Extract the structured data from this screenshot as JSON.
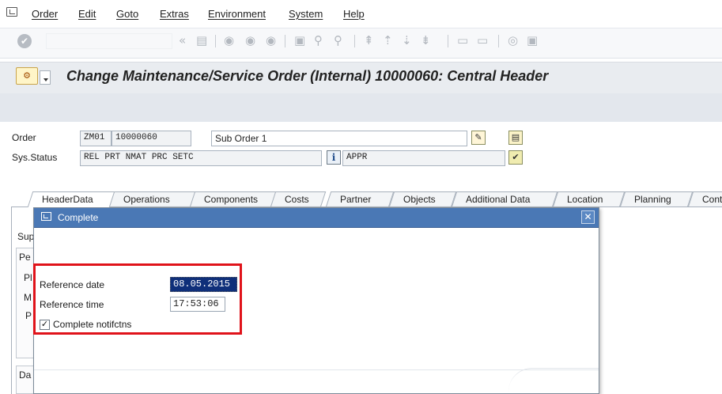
{
  "menu": {
    "items": [
      {
        "label": "Order"
      },
      {
        "label": "Edit"
      },
      {
        "label": "Goto"
      },
      {
        "label": "Extras"
      },
      {
        "label": "Environment"
      },
      {
        "label": "System"
      },
      {
        "label": "Help"
      }
    ]
  },
  "toolbar": {
    "icons": [
      "enter-icon",
      "back-icon",
      "save-icon",
      "back-nav-icon",
      "exit-icon",
      "cancel-icon",
      "print-icon",
      "find-icon",
      "find-next-icon",
      "first-page-icon",
      "prev-page-icon",
      "next-page-icon",
      "last-page-icon",
      "new-session-icon",
      "shortcut-icon",
      "help-icon",
      "layout-icon"
    ]
  },
  "title": {
    "text": "Change Maintenance/Service Order (Internal) 10000060: Central Header"
  },
  "header": {
    "order_label": "Order",
    "order_type": "ZM01",
    "order_number": "10000060",
    "order_desc": "Sub Order 1",
    "status_label": "Sys.Status",
    "sys_status": "REL  PRT  NMAT PRC  SETC",
    "user_status": "APPR"
  },
  "tabs": [
    {
      "label": "HeaderData"
    },
    {
      "label": "Operations"
    },
    {
      "label": "Components"
    },
    {
      "label": "Costs"
    },
    {
      "label": "Partner"
    },
    {
      "label": "Objects"
    },
    {
      "label": "Additional Data"
    },
    {
      "label": "Location"
    },
    {
      "label": "Planning"
    },
    {
      "label": "Contr"
    }
  ],
  "behind": {
    "label1": "Sup",
    "label2": "Pe",
    "label3": "Pl",
    "label4": "M",
    "label5": "P",
    "label6": "Da"
  },
  "dialog": {
    "title": "Complete",
    "ref_date_label": "Reference date",
    "ref_date_value": "08.05.2015",
    "ref_time_label": "Reference time",
    "ref_time_value": "17:53:06",
    "complete_label": "Complete notifctns",
    "complete_checked": true
  },
  "colors": {
    "dialog_header": "#4a78b5",
    "highlight": "#e0131a",
    "selection": "#0f2f7a"
  }
}
